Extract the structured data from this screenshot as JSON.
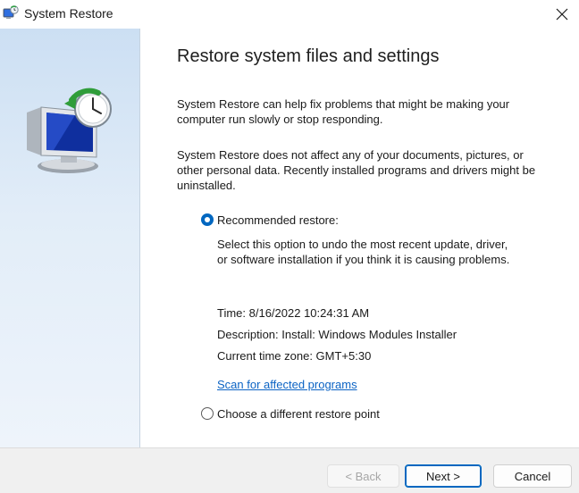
{
  "window": {
    "title": "System Restore",
    "close_icon": "close-icon"
  },
  "colors": {
    "accent": "#0067c0",
    "link": "#0b63c4",
    "side_panel": "#d6e6f5",
    "footer": "#f0f0f0"
  },
  "page": {
    "title": "Restore system files and settings",
    "paragraph_1": "System Restore can help fix problems that might be making your computer run slowly or stop responding.",
    "paragraph_2": "System Restore does not affect any of your documents, pictures, or other personal data. Recently installed programs and drivers might be uninstalled."
  },
  "options": {
    "recommended": {
      "label": "Recommended restore:",
      "checked": true,
      "description": "Select this option to undo the most recent update, driver, or software installation if you think it is causing problems.",
      "time": "Time: 8/16/2022 10:24:31 AM",
      "detail": "Description: Install: Windows Modules Installer",
      "timezone": "Current time zone: GMT+5:30",
      "scan_link": "Scan for affected programs"
    },
    "different": {
      "label": "Choose a different restore point",
      "checked": false
    }
  },
  "buttons": {
    "back": "< Back",
    "next": "Next >",
    "cancel": "Cancel"
  }
}
